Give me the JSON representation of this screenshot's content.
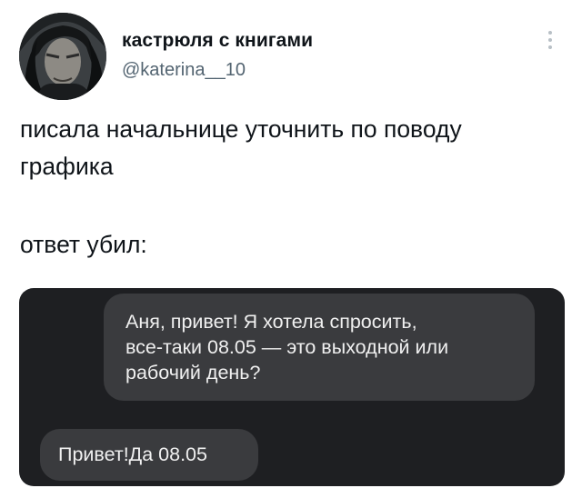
{
  "tweet": {
    "author": {
      "display_name": "кастрюля с книгами",
      "handle": "@katerina__10",
      "avatar": "avatar-image"
    },
    "more_icon": "more-vertical-icon",
    "text_lines": [
      "писала начальнице уточнить по поводу",
      "графика",
      "ответ убил:"
    ]
  },
  "embedded_chat": {
    "background": "#1e1f22",
    "bubble_color": "#3a3b3e",
    "sent_message": {
      "lines": [
        "Аня, привет! Я хотела спросить,",
        "все-таки 08.05 — это выходной или",
        "рабочий день?"
      ]
    },
    "received_message": {
      "text": "Привет!Да 08.05"
    }
  }
}
